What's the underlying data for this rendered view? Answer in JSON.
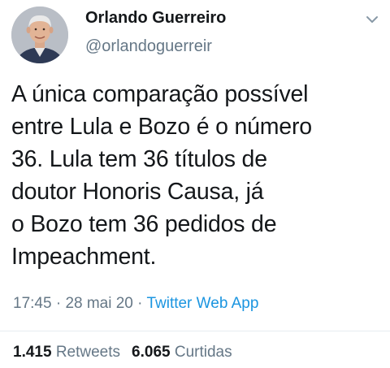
{
  "author": {
    "display_name": "Orlando Guerreiro",
    "handle": "@orlandoguerreir",
    "avatar": "profile-photo"
  },
  "tweet": {
    "lines": [
      "A única comparação possível",
      "entre Lula e Bozo é o número",
      "36. Lula tem 36 títulos de",
      "doutor Honoris Causa, já",
      "o Bozo tem 36 pedidos de",
      "Impeachment."
    ]
  },
  "meta": {
    "time": "17:45",
    "sep1": " · ",
    "date": "28 mai 20",
    "sep2": " · ",
    "source": "Twitter Web App"
  },
  "stats": {
    "retweets_count": "1.415",
    "retweets_label": "Retweets",
    "likes_count": "6.065",
    "likes_label": "Curtidas"
  },
  "icons": {
    "more": "chevron-down-icon"
  },
  "colors": {
    "text": "#14171a",
    "secondary": "#657786",
    "link": "#1b95e0",
    "divider": "#e6ecf0"
  }
}
